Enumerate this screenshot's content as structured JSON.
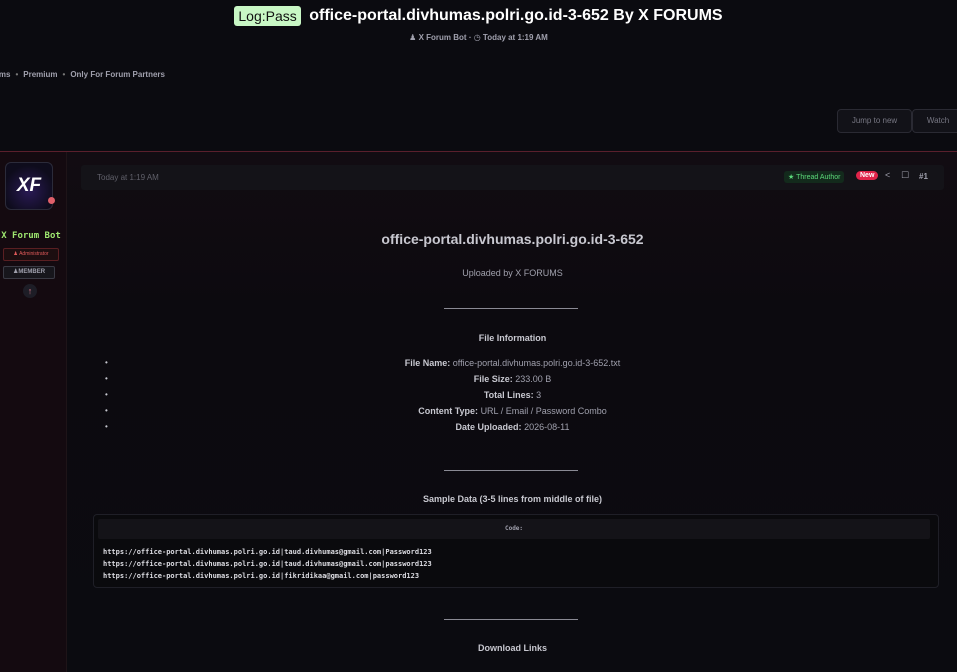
{
  "header": {
    "prefix": "Log:Pass",
    "title": "office-portal.divhumas.polri.go.id-3-652 By X FORUMS",
    "author": "X Forum Bot",
    "date": "Today at 1:19 AM",
    "breadcrumbs": [
      "ums",
      "Premium",
      "Only For Forum Partners"
    ],
    "jump_label": "Jump to new",
    "watch_label": "Watch"
  },
  "sidebar": {
    "avatar_text": "XF",
    "username": "X Forum Bot",
    "role_badge": "Administrator",
    "member_badge": "MEMBER"
  },
  "post": {
    "date": "Today at 1:19 AM",
    "thread_author": "Thread Author",
    "new_badge": "New",
    "number": "#1",
    "file_heading": "office-portal.divhumas.polri.go.id-3-652",
    "uploaded_by": "Uploaded by X FORUMS",
    "file_info_title": "File Information",
    "file_info": [
      {
        "label": "File Name:",
        "value": "office-portal.divhumas.polri.go.id-3-652.txt"
      },
      {
        "label": "File Size:",
        "value": "233.00 B"
      },
      {
        "label": "Total Lines:",
        "value": "3"
      },
      {
        "label": "Content Type:",
        "value": "URL / Email / Password Combo"
      },
      {
        "label": "Date Uploaded:",
        "value": "2026-08-11"
      }
    ],
    "sample_title": "Sample Data (3-5 lines from middle of file)",
    "code_label": "Code:",
    "code_lines": [
      "https://office-portal.divhumas.polri.go.id|taud.divhumas@gmail.com|Password123",
      "https://office-portal.divhumas.polri.go.id|taud.divhumas@gmail.com|password123",
      "https://office-portal.divhumas.polri.go.id|fikridikaa@gmail.com|password123"
    ],
    "download_title": "Download Links"
  }
}
